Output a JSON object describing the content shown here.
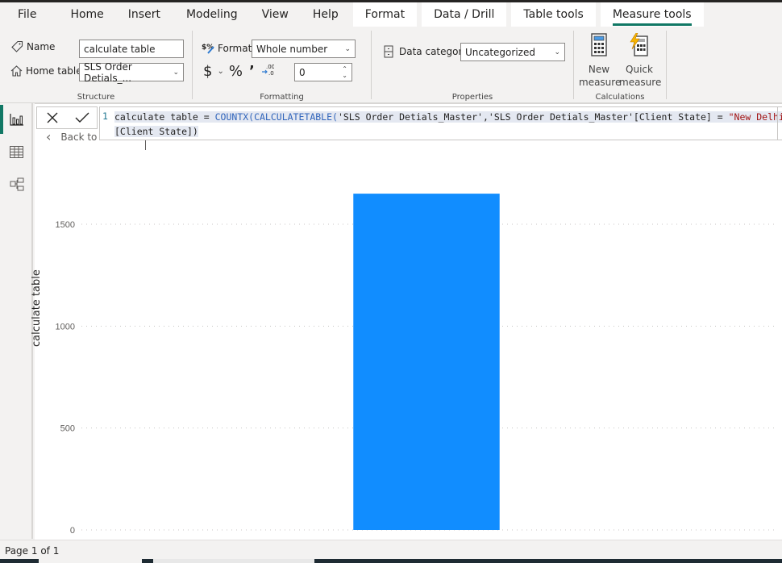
{
  "ribbon_tabs": [
    {
      "label": "File"
    },
    {
      "label": "Home"
    },
    {
      "label": "Insert"
    },
    {
      "label": "Modeling"
    },
    {
      "label": "View"
    },
    {
      "label": "Help"
    },
    {
      "label": "Format"
    },
    {
      "label": "Data / Drill"
    },
    {
      "label": "Table tools"
    },
    {
      "label": "Measure tools",
      "active": true
    }
  ],
  "structure": {
    "name_label": "Name",
    "name_value": "calculate table",
    "home_table_label": "Home table",
    "home_table_value": "SLS Order Detials_...",
    "group_label": "Structure"
  },
  "formatting": {
    "format_label": "Format",
    "format_value": "Whole number",
    "currency_symbol": "$",
    "percent_symbol": "%",
    "comma_symbol": "❟",
    "decimal_places": "0",
    "group_label": "Formatting"
  },
  "properties": {
    "data_category_label": "Data category",
    "data_category_value": "Uncategorized",
    "group_label": "Properties"
  },
  "calculations": {
    "new_measure_line1": "New",
    "new_measure_line2": "measure",
    "quick_measure_line1": "Quick",
    "quick_measure_line2": "measure",
    "group_label": "Calculations"
  },
  "formula_bar": {
    "line_number": "1",
    "part1": "calculate table = ",
    "fn1": "COUNTX(CALCULATETABLE(",
    "part2": "'SLS Order Detials_Master','SLS Order Detials_Master'[Client State] = ",
    "str1": "\"New Delhi\"",
    "part3": "),",
    "line2": "[Client State])"
  },
  "back_to_label": "Back to",
  "page_status": "Page 1 of 1",
  "colors": {
    "accent": "#117865",
    "bar": "#118dff"
  },
  "chart_data": {
    "type": "bar",
    "categories": [
      ""
    ],
    "values": [
      1650
    ],
    "title": "",
    "xlabel": "",
    "ylabel": "calculate table",
    "ylim": [
      0,
      1750
    ],
    "yticks": [
      0,
      500,
      1000,
      1500
    ],
    "grid": true
  }
}
